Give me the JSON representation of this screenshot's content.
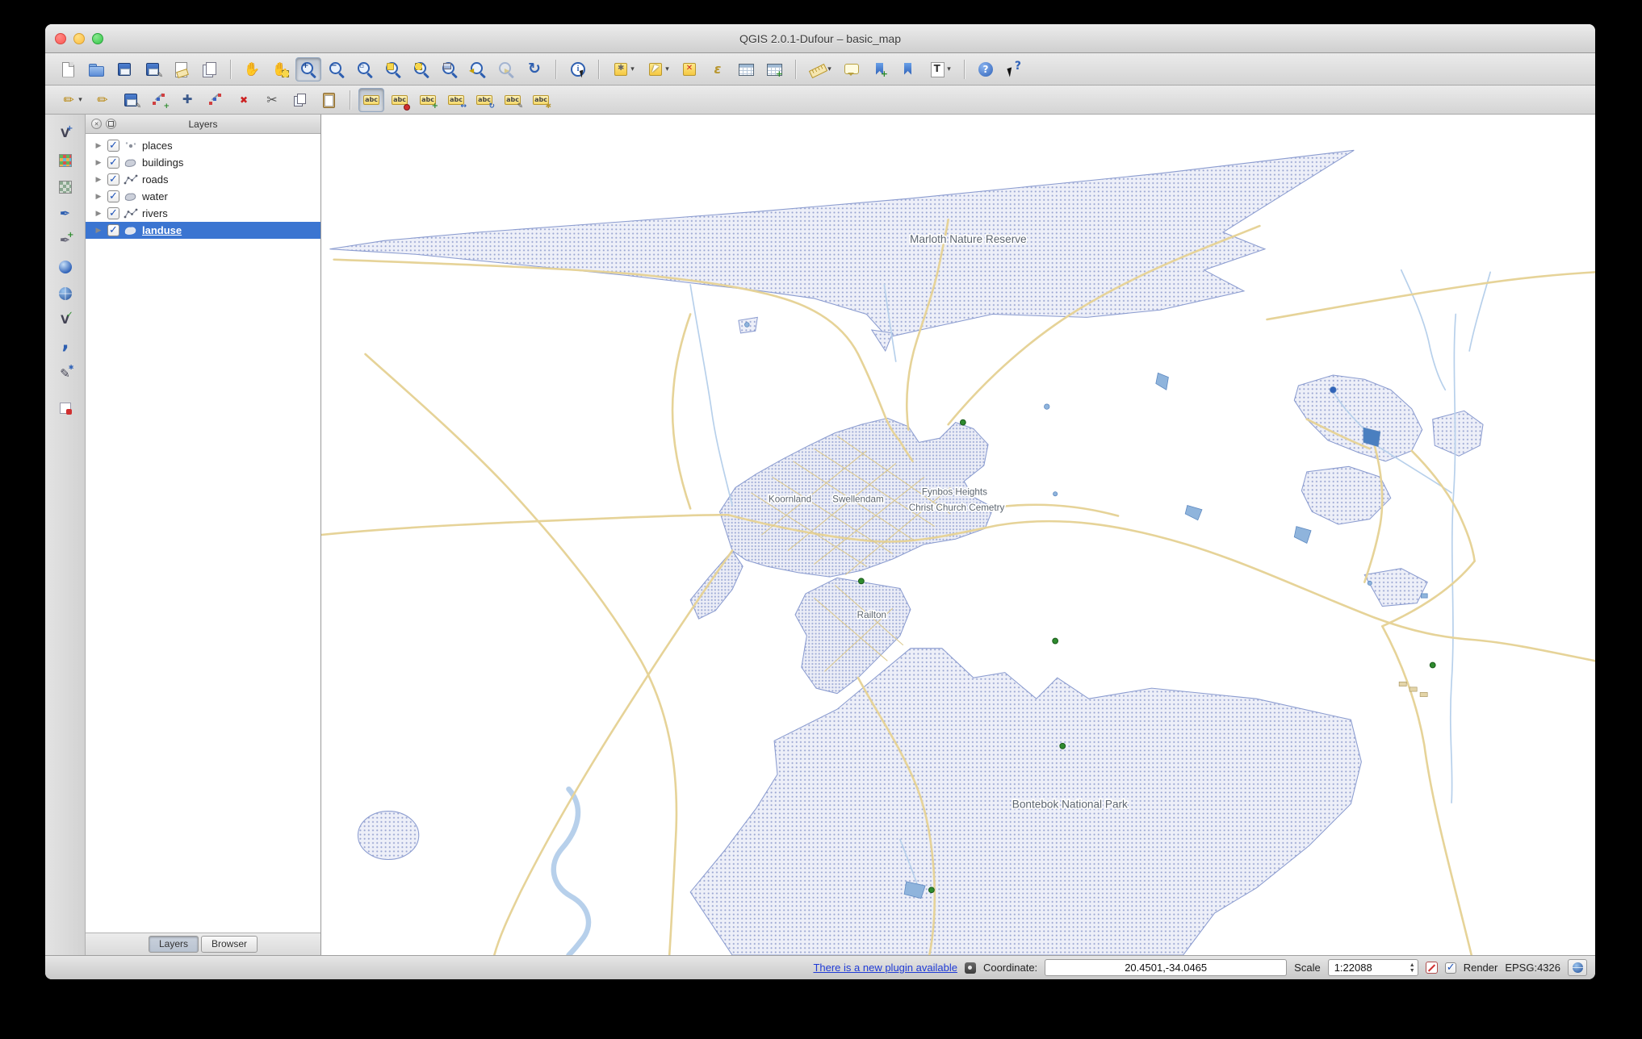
{
  "window": {
    "title": "QGIS 2.0.1-Dufour – basic_map"
  },
  "toolbar_main": {
    "items": [
      {
        "name": "New Project"
      },
      {
        "name": "Open Project"
      },
      {
        "name": "Save Project"
      },
      {
        "name": "Save Project As"
      },
      {
        "name": "New Print Composer"
      },
      {
        "name": "Composer Manager"
      },
      {
        "name": "Pan Map"
      },
      {
        "name": "Pan Map to Selection"
      },
      {
        "name": "Zoom In"
      },
      {
        "name": "Zoom Out"
      },
      {
        "name": "Zoom to Native Resolution"
      },
      {
        "name": "Zoom Full"
      },
      {
        "name": "Zoom to Selection"
      },
      {
        "name": "Zoom to Layer"
      },
      {
        "name": "Zoom Last"
      },
      {
        "name": "Zoom Next"
      },
      {
        "name": "Refresh Map"
      },
      {
        "name": "Identify Features"
      },
      {
        "name": "Run Feature Action"
      },
      {
        "name": "Select Features"
      },
      {
        "name": "Deselect Features from All Layers"
      },
      {
        "name": "Select Features by Expression"
      },
      {
        "name": "Open Attribute Table"
      },
      {
        "name": "Field Calculator"
      },
      {
        "name": "Measure Line"
      },
      {
        "name": "Map Tips"
      },
      {
        "name": "New Bookmark"
      },
      {
        "name": "Show Bookmarks"
      },
      {
        "name": "Text Annotation"
      },
      {
        "name": "Help Contents"
      },
      {
        "name": "What's This?"
      }
    ]
  },
  "toolbar_edit": {
    "items": [
      {
        "name": "Current Edits"
      },
      {
        "name": "Toggle Editing"
      },
      {
        "name": "Save Layer Edits"
      },
      {
        "name": "Add Feature"
      },
      {
        "name": "Move Feature"
      },
      {
        "name": "Node Tool"
      },
      {
        "name": "Delete Selected"
      },
      {
        "name": "Cut Features"
      },
      {
        "name": "Copy Features"
      },
      {
        "name": "Paste Features"
      },
      {
        "name": "Labeling"
      },
      {
        "name": "Pin/Unpin Labels"
      },
      {
        "name": "Show/Hide Labels"
      },
      {
        "name": "Move Label"
      },
      {
        "name": "Rotate Label"
      },
      {
        "name": "Change Label"
      },
      {
        "name": "Change Label Properties"
      }
    ]
  },
  "layer_toolbar": {
    "items": [
      {
        "name": "Add Vector Layer"
      },
      {
        "name": "Add Raster Layer"
      },
      {
        "name": "Add PostGIS Layer"
      },
      {
        "name": "Add SpatiaLite Layer"
      },
      {
        "name": "Add MSSQL Layer"
      },
      {
        "name": "Add Oracle Layer"
      },
      {
        "name": "Add WMS/WMTS Layer"
      },
      {
        "name": "Add WFS Layer"
      },
      {
        "name": "Add Delimited Text Layer"
      },
      {
        "name": "New Shapefile Layer"
      },
      {
        "name": "Remove Layer"
      }
    ]
  },
  "layers_panel": {
    "title": "Layers",
    "items": [
      {
        "label": "places",
        "type": "point",
        "checked": true,
        "selected": false
      },
      {
        "label": "buildings",
        "type": "polygon",
        "checked": true,
        "selected": false
      },
      {
        "label": "roads",
        "type": "line",
        "checked": true,
        "selected": false
      },
      {
        "label": "water",
        "type": "polygon",
        "checked": true,
        "selected": false
      },
      {
        "label": "rivers",
        "type": "line",
        "checked": true,
        "selected": false
      },
      {
        "label": "landuse",
        "type": "polygon",
        "checked": true,
        "selected": true
      }
    ],
    "tabs": [
      {
        "label": "Layers",
        "active": true
      },
      {
        "label": "Browser",
        "active": false
      }
    ]
  },
  "map": {
    "labels": [
      {
        "text": "Marloth Nature Reserve"
      },
      {
        "text": "Koornland"
      },
      {
        "text": "Swellendam"
      },
      {
        "text": "Fynbos Heights"
      },
      {
        "text": "Christ Church Cemetry"
      },
      {
        "text": "Railton"
      },
      {
        "text": "Bontebok National Park"
      }
    ]
  },
  "status_bar": {
    "plugin_link": "There is a new plugin available",
    "coordinate_label": "Coordinate:",
    "coordinate_value": "20.4501,-34.0465",
    "scale_label": "Scale",
    "scale_value": "1:22088",
    "render_label": "Render",
    "render_checked": true,
    "crs": "EPSG:4326"
  },
  "colors": {
    "selection_blue": "#3b75d1",
    "road_tan": "#e6d398",
    "river_blue": "#b7d0eb",
    "landuse_fill": "#edeff8",
    "landuse_dot": "#9aa6d2",
    "water_fill": "#8fb4dc",
    "place_green": "#2e8b2e"
  }
}
